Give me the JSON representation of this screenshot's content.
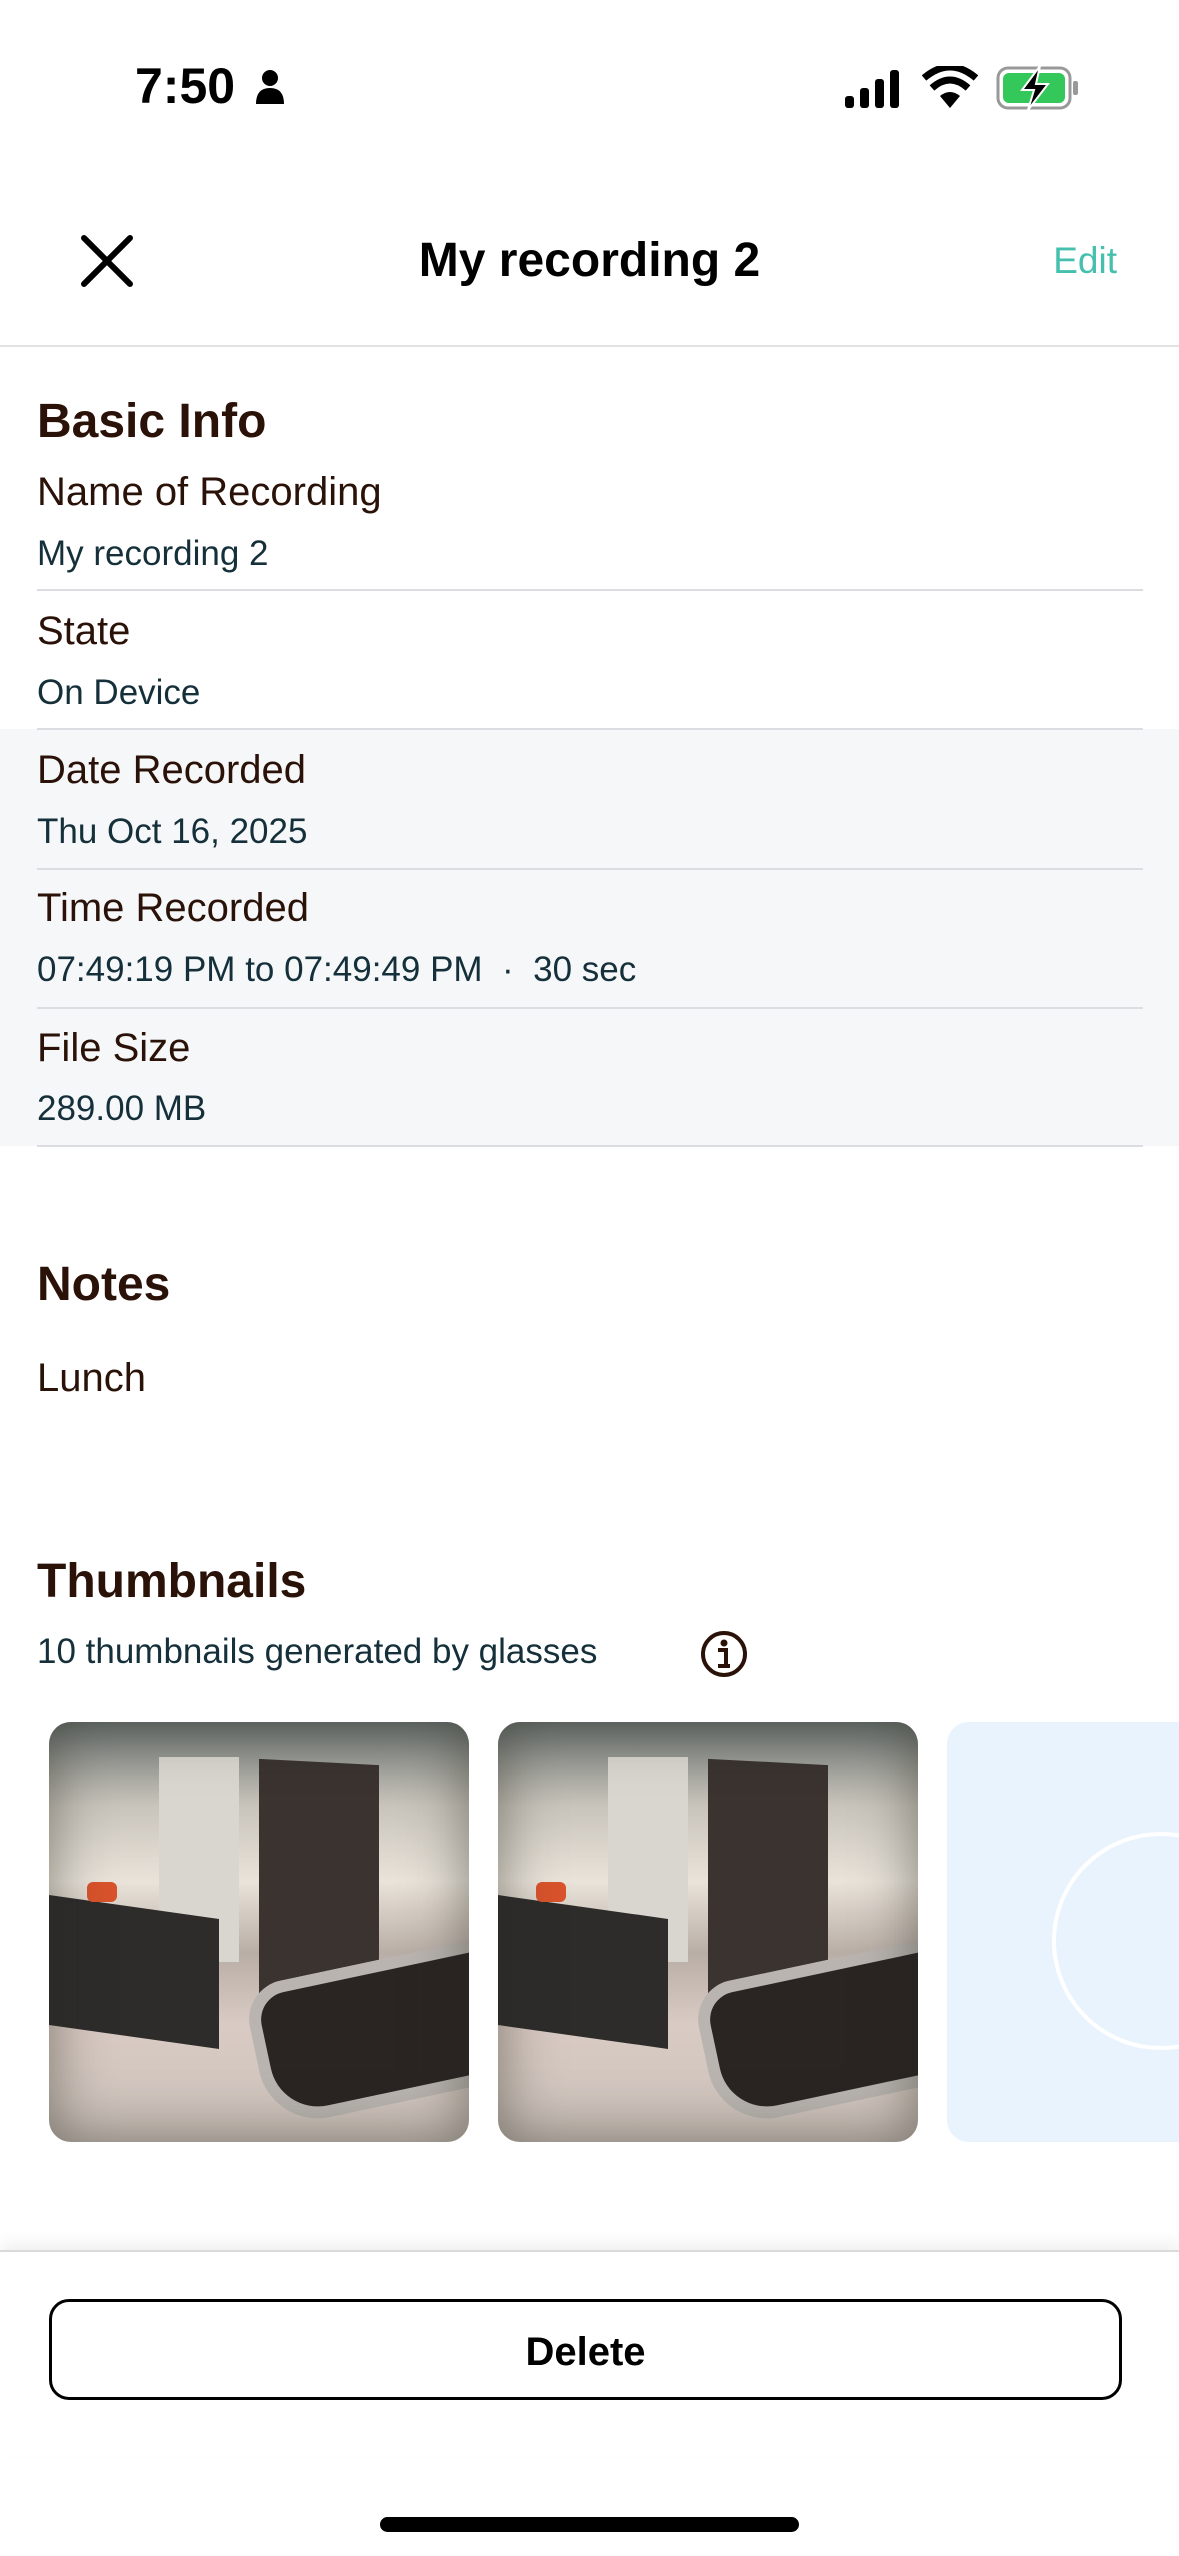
{
  "status_bar": {
    "time": "7:50",
    "icons": [
      "person-icon",
      "cellular-signal-icon",
      "wifi-icon",
      "battery-charging-icon"
    ],
    "battery_color": "#34c759"
  },
  "header": {
    "title": "My recording 2",
    "edit_label": "Edit",
    "close_icon": "close-icon",
    "accent_color": "#45bfae"
  },
  "basic_info": {
    "heading": "Basic Info",
    "fields": [
      {
        "label": "Name of Recording",
        "value": "My recording 2"
      },
      {
        "label": "State",
        "value": "On Device"
      },
      {
        "label": "Date Recorded",
        "value": "Thu Oct 16, 2025"
      },
      {
        "label": "Time Recorded",
        "value": "07:49:19 PM to 07:49:49 PM  ·  30 sec"
      },
      {
        "label": "File Size",
        "value": "289.00 MB"
      }
    ]
  },
  "notes": {
    "heading": "Notes",
    "text": "Lunch"
  },
  "thumbnails": {
    "heading": "Thumbnails",
    "subtitle": "10 thumbnails generated by glasses",
    "info_icon": "info-icon"
  },
  "footer": {
    "delete_label": "Delete"
  }
}
